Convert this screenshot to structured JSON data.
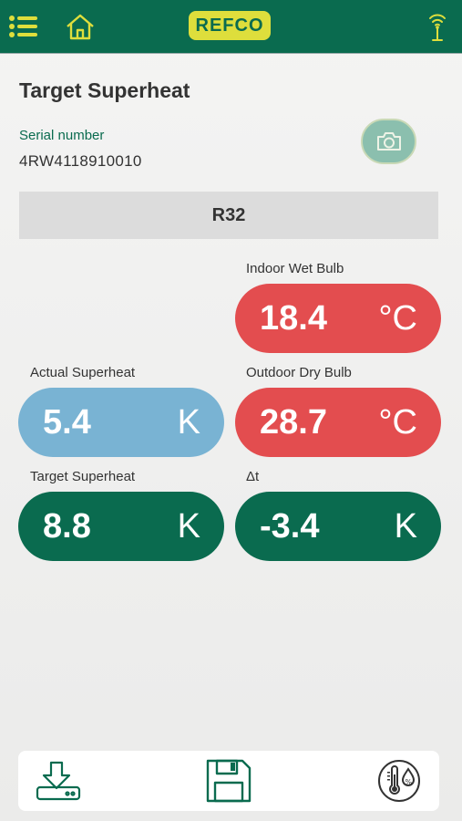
{
  "header": {
    "logo_text": "REFCO",
    "icons": [
      "menu-icon",
      "home-icon",
      "wireless-icon"
    ],
    "colors": {
      "bar": "#0a6b4f",
      "icon": "#dede3c"
    }
  },
  "page": {
    "title": "Target Superheat",
    "serial_label": "Serial number",
    "serial_value": "4RW4118910010",
    "refrigerant": "R32"
  },
  "measurements": {
    "indoor_wet_bulb": {
      "label": "Indoor Wet Bulb",
      "value": "18.4",
      "unit": "°C",
      "color": "#e34d4f"
    },
    "actual_superheat": {
      "label": "Actual Superheat",
      "value": "5.4",
      "unit": "K",
      "color": "#79b3d3"
    },
    "outdoor_dry_bulb": {
      "label": "Outdoor Dry Bulb",
      "value": "28.7",
      "unit": "°C",
      "color": "#e34d4f"
    },
    "target_superheat": {
      "label": "Target Superheat",
      "value": "8.8",
      "unit": "K",
      "color": "#0a6b4f"
    },
    "delta_t": {
      "label": "Δt",
      "value": "-3.4",
      "unit": "K",
      "color": "#0a6b4f"
    }
  },
  "footer": {
    "icons": [
      "download-icon",
      "save-icon",
      "temperature-humidity-icon"
    ]
  }
}
